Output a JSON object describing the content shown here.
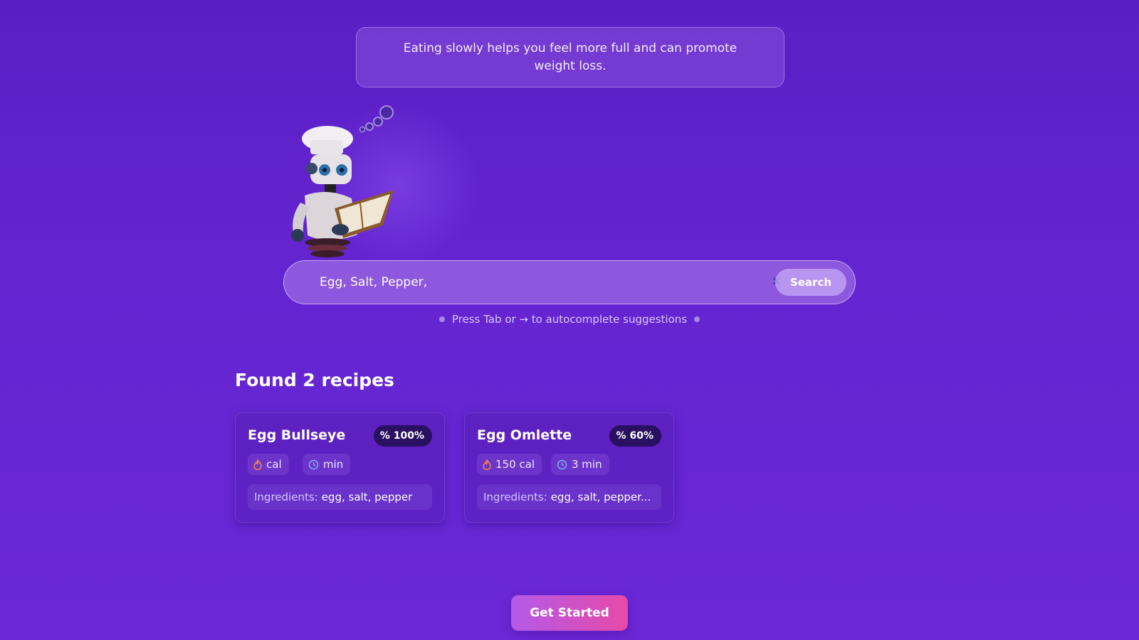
{
  "tip": {
    "text": "Eating slowly helps you feel more full and can promote weight loss."
  },
  "search": {
    "value": "Egg, Salt, Pepper, ",
    "button_label": "Search",
    "clear_icon": "close-icon"
  },
  "hint": {
    "text": "Press Tab or → to autocomplete suggestions"
  },
  "results": {
    "title": "Found 2 recipes",
    "cards": [
      {
        "title": "Egg Bullseye",
        "match": "100%",
        "calories": "cal",
        "time": "min",
        "ingredients_label": "Ingredients:",
        "ingredients": "egg, salt, pepper"
      },
      {
        "title": "Egg Omlette",
        "match": "60%",
        "calories": "150 cal",
        "time": "3 min",
        "ingredients_label": "Ingredients:",
        "ingredients": "egg, salt, pepper..."
      }
    ]
  },
  "cta": {
    "label": "Get Started"
  },
  "colors": {
    "background": "#6424d0",
    "badge_bg": "#2a1060",
    "cta_start": "#b45ae8",
    "cta_end": "#e64aa8",
    "flame": "#ff8a3d",
    "clock": "#7fb6ff"
  }
}
